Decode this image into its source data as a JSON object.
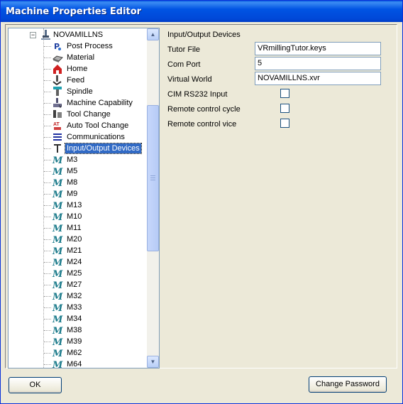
{
  "window": {
    "title": "Machine Properties Editor"
  },
  "tree": {
    "root_label": "NOVAMILLNS",
    "items": [
      {
        "label": "Post Process",
        "icon": "post-process-icon"
      },
      {
        "label": "Material",
        "icon": "material-icon"
      },
      {
        "label": "Home",
        "icon": "home-icon"
      },
      {
        "label": "Feed",
        "icon": "feed-icon"
      },
      {
        "label": "Spindle",
        "icon": "spindle-icon"
      },
      {
        "label": "Machine Capability",
        "icon": "machine-capability-icon"
      },
      {
        "label": "Tool Change",
        "icon": "tool-change-icon"
      },
      {
        "label": "Auto Tool Change",
        "icon": "auto-tool-change-icon"
      },
      {
        "label": "Communications",
        "icon": "communications-icon"
      },
      {
        "label": "Input/Output Devices",
        "icon": "io-devices-icon"
      },
      {
        "label": "M3",
        "icon": "m-code-icon"
      },
      {
        "label": "M5",
        "icon": "m-code-icon"
      },
      {
        "label": "M8",
        "icon": "m-code-icon"
      },
      {
        "label": "M9",
        "icon": "m-code-icon"
      },
      {
        "label": "M13",
        "icon": "m-code-icon"
      },
      {
        "label": "M10",
        "icon": "m-code-icon"
      },
      {
        "label": "M11",
        "icon": "m-code-icon"
      },
      {
        "label": "M20",
        "icon": "m-code-icon"
      },
      {
        "label": "M21",
        "icon": "m-code-icon"
      },
      {
        "label": "M24",
        "icon": "m-code-icon"
      },
      {
        "label": "M25",
        "icon": "m-code-icon"
      },
      {
        "label": "M27",
        "icon": "m-code-icon"
      },
      {
        "label": "M32",
        "icon": "m-code-icon"
      },
      {
        "label": "M33",
        "icon": "m-code-icon"
      },
      {
        "label": "M34",
        "icon": "m-code-icon"
      },
      {
        "label": "M38",
        "icon": "m-code-icon"
      },
      {
        "label": "M39",
        "icon": "m-code-icon"
      },
      {
        "label": "M62",
        "icon": "m-code-icon"
      },
      {
        "label": "M64",
        "icon": "m-code-icon"
      }
    ],
    "selected": "Input/Output Devices"
  },
  "properties": {
    "section_title": "Input/Output Devices",
    "tutor_file_label": "Tutor File",
    "tutor_file_value": "VRmillingTutor.keys",
    "com_port_label": "Com Port",
    "com_port_value": "5",
    "virtual_world_label": "Virtual World",
    "virtual_world_value": "NOVAMILLNS.xvr",
    "cim_label": "CIM RS232 Input",
    "remote_cycle_label": "Remote control cycle",
    "remote_vice_label": "Remote control vice"
  },
  "buttons": {
    "ok": "OK",
    "change_password": "Change Password"
  }
}
